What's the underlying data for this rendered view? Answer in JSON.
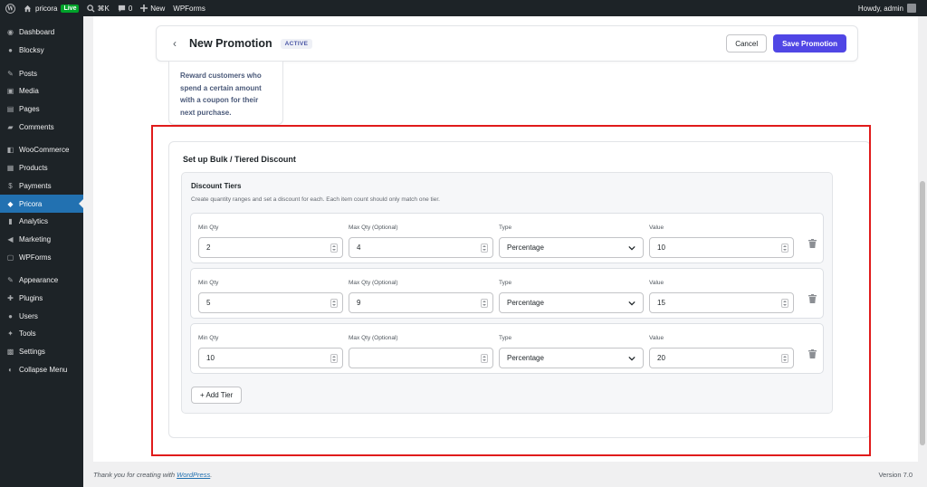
{
  "adminbar": {
    "site_name": "pricora",
    "live_badge": "Live",
    "shortcut": "⌘K",
    "comments_count": "0",
    "new_label": "New",
    "wpforms_label": "WPForms",
    "howdy": "Howdy, admin"
  },
  "sidebar": {
    "items": [
      {
        "label": "Dashboard",
        "icon": "dashboard-icon"
      },
      {
        "label": "Blocksy",
        "icon": "blocksy-icon"
      },
      {
        "label": "Posts",
        "icon": "pin-icon"
      },
      {
        "label": "Media",
        "icon": "media-icon"
      },
      {
        "label": "Pages",
        "icon": "page-icon"
      },
      {
        "label": "Comments",
        "icon": "comment-icon"
      },
      {
        "label": "WooCommerce",
        "icon": "woocommerce-icon"
      },
      {
        "label": "Products",
        "icon": "archive-icon"
      },
      {
        "label": "Payments",
        "icon": "dollar-icon"
      },
      {
        "label": "Pricora",
        "icon": "pricora-icon"
      },
      {
        "label": "Analytics",
        "icon": "bar-chart-icon"
      },
      {
        "label": "Marketing",
        "icon": "megaphone-icon"
      },
      {
        "label": "WPForms",
        "icon": "form-icon"
      },
      {
        "label": "Appearance",
        "icon": "brush-icon"
      },
      {
        "label": "Plugins",
        "icon": "plug-icon"
      },
      {
        "label": "Users",
        "icon": "user-icon"
      },
      {
        "label": "Tools",
        "icon": "wrench-icon"
      },
      {
        "label": "Settings",
        "icon": "settings-icon"
      },
      {
        "label": "Collapse Menu",
        "icon": "collapse-icon"
      }
    ],
    "active_color": "#2271b1"
  },
  "header": {
    "title": "New Promotion",
    "status": "ACTIVE",
    "cancel_label": "Cancel",
    "save_label": "Save Promotion",
    "accent_color": "#5046e5"
  },
  "type_card": {
    "description": "Reward customers who spend a certain amount with a coupon for their next purchase."
  },
  "bulk_section": {
    "title": "Set up Bulk / Tiered Discount",
    "tiers_title": "Discount Tiers",
    "tiers_help": "Create quantity ranges and set a discount for each. Each item count should only match one tier.",
    "labels": {
      "min_qty": "Min Qty",
      "max_qty": "Max Qty (Optional)",
      "type": "Type",
      "value": "Value"
    },
    "tiers": [
      {
        "min_qty": "2",
        "max_qty": "4",
        "type": "Percentage",
        "value": "10"
      },
      {
        "min_qty": "5",
        "max_qty": "9",
        "type": "Percentage",
        "value": "15"
      },
      {
        "min_qty": "10",
        "max_qty": "",
        "type": "Percentage",
        "value": "20"
      }
    ],
    "add_tier_label": "+ Add Tier"
  },
  "footer": {
    "thanks_prefix": "Thank you for creating with ",
    "wordpress_link": "WordPress",
    "thanks_suffix": ".",
    "version": "Version 7.0"
  }
}
